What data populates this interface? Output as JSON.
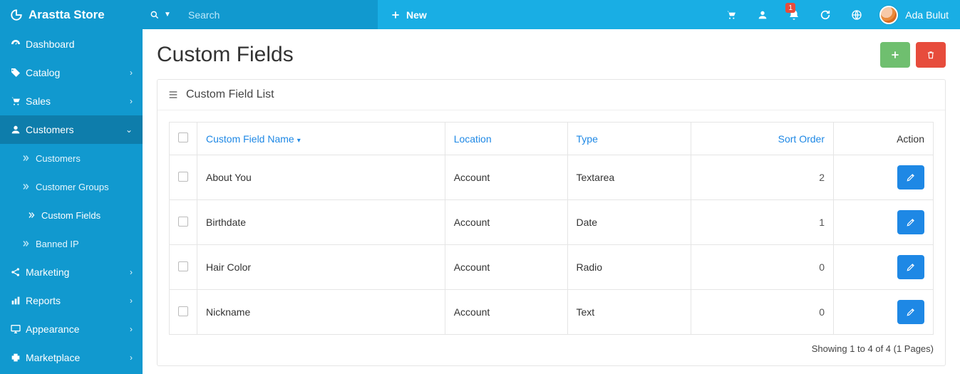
{
  "brand": {
    "name": "Arastta Store"
  },
  "sidebar": {
    "items": [
      {
        "label": "Dashboard",
        "icon": "dashboard"
      },
      {
        "label": "Catalog",
        "icon": "tag",
        "chevron": true
      },
      {
        "label": "Sales",
        "icon": "cart",
        "chevron": true
      },
      {
        "label": "Customers",
        "icon": "user",
        "chevron": true,
        "expanded": true,
        "children": [
          {
            "label": "Customers"
          },
          {
            "label": "Customer Groups"
          },
          {
            "label": "Custom Fields",
            "active": true
          },
          {
            "label": "Banned IP"
          }
        ]
      },
      {
        "label": "Marketing",
        "icon": "share",
        "chevron": true
      },
      {
        "label": "Reports",
        "icon": "bar",
        "chevron": true
      },
      {
        "label": "Appearance",
        "icon": "monitor",
        "chevron": true
      },
      {
        "label": "Marketplace",
        "icon": "puzzle",
        "chevron": true
      }
    ]
  },
  "topbar": {
    "search_placeholder": "Search",
    "new_label": "New",
    "notif_count": "1",
    "user_name": "Ada Bulut"
  },
  "page": {
    "title": "Custom Fields",
    "panel_title": "Custom Field List",
    "columns": {
      "name": "Custom Field Name",
      "location": "Location",
      "type": "Type",
      "sort": "Sort Order",
      "action": "Action"
    },
    "rows": [
      {
        "name": "About You",
        "location": "Account",
        "type": "Textarea",
        "sort": "2"
      },
      {
        "name": "Birthdate",
        "location": "Account",
        "type": "Date",
        "sort": "1"
      },
      {
        "name": "Hair Color",
        "location": "Account",
        "type": "Radio",
        "sort": "0"
      },
      {
        "name": "Nickname",
        "location": "Account",
        "type": "Text",
        "sort": "0"
      }
    ],
    "pagination": "Showing 1 to 4 of 4 (1 Pages)"
  }
}
